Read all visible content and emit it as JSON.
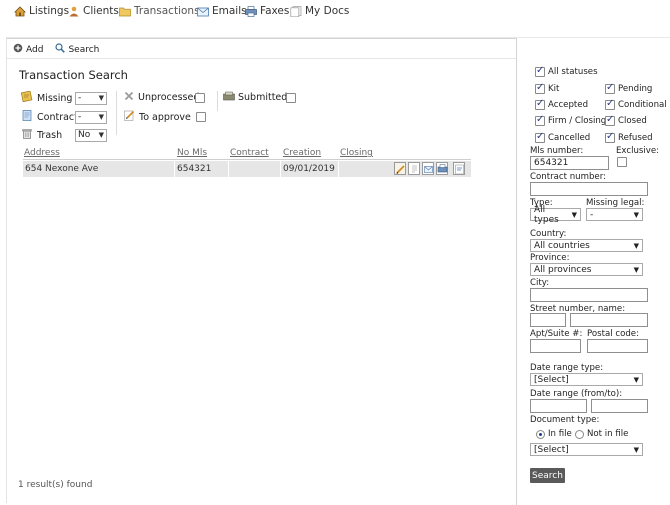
{
  "nav": {
    "listings": "Listings",
    "clients": "Clients",
    "transactions": "Transactions",
    "emails": "Emails",
    "faxes": "Faxes",
    "mydocs": "My Docs"
  },
  "toolbar": {
    "add": "Add",
    "search": "Search"
  },
  "title": "Transaction Search",
  "filters": {
    "missing_label": "Missing",
    "missing_value": "-",
    "contract_label": "Contract",
    "contract_value": "-",
    "trash_label": "Trash",
    "trash_value": "No",
    "unprocessed_label": "Unprocessed",
    "to_approve_label": "To approve",
    "submitted_label": "Submitted"
  },
  "table": {
    "headers": [
      "Address",
      "No Mls",
      "Contract",
      "Creation",
      "Closing"
    ],
    "rows": [
      {
        "address": "654 Nexone Ave",
        "mls": "654321",
        "contract": "",
        "creation": "09/01/2019",
        "closing": ""
      }
    ]
  },
  "result_text": "1 result(s) found",
  "sidebar": {
    "all_statuses": "All statuses",
    "statuses_left": [
      "Kit",
      "Accepted",
      "Firm / Closing",
      "Cancelled"
    ],
    "statuses_right": [
      "Pending",
      "Conditional",
      "Closed",
      "Refused"
    ],
    "mls_label": "Mls number:",
    "mls_value": "654321",
    "exclusive_label": "Exclusive:",
    "contract_number_label": "Contract number:",
    "type_label": "Type:",
    "type_value": "All types",
    "missing_legal_label": "Missing legal:",
    "missing_legal_value": "-",
    "country_label": "Country:",
    "country_value": "All countries",
    "province_label": "Province:",
    "province_value": "All provinces",
    "city_label": "City:",
    "street_label": "Street number, name:",
    "apt_label": "Apt/Suite #:",
    "postal_label": "Postal code:",
    "date_range_type_label": "Date range type:",
    "date_range_type_value": "[Select]",
    "date_range_label": "Date range (from/to):",
    "document_type_label": "Document type:",
    "in_file_label": "In file",
    "not_in_file_label": "Not in file",
    "document_value": "[Select]",
    "search_button": "Search"
  }
}
